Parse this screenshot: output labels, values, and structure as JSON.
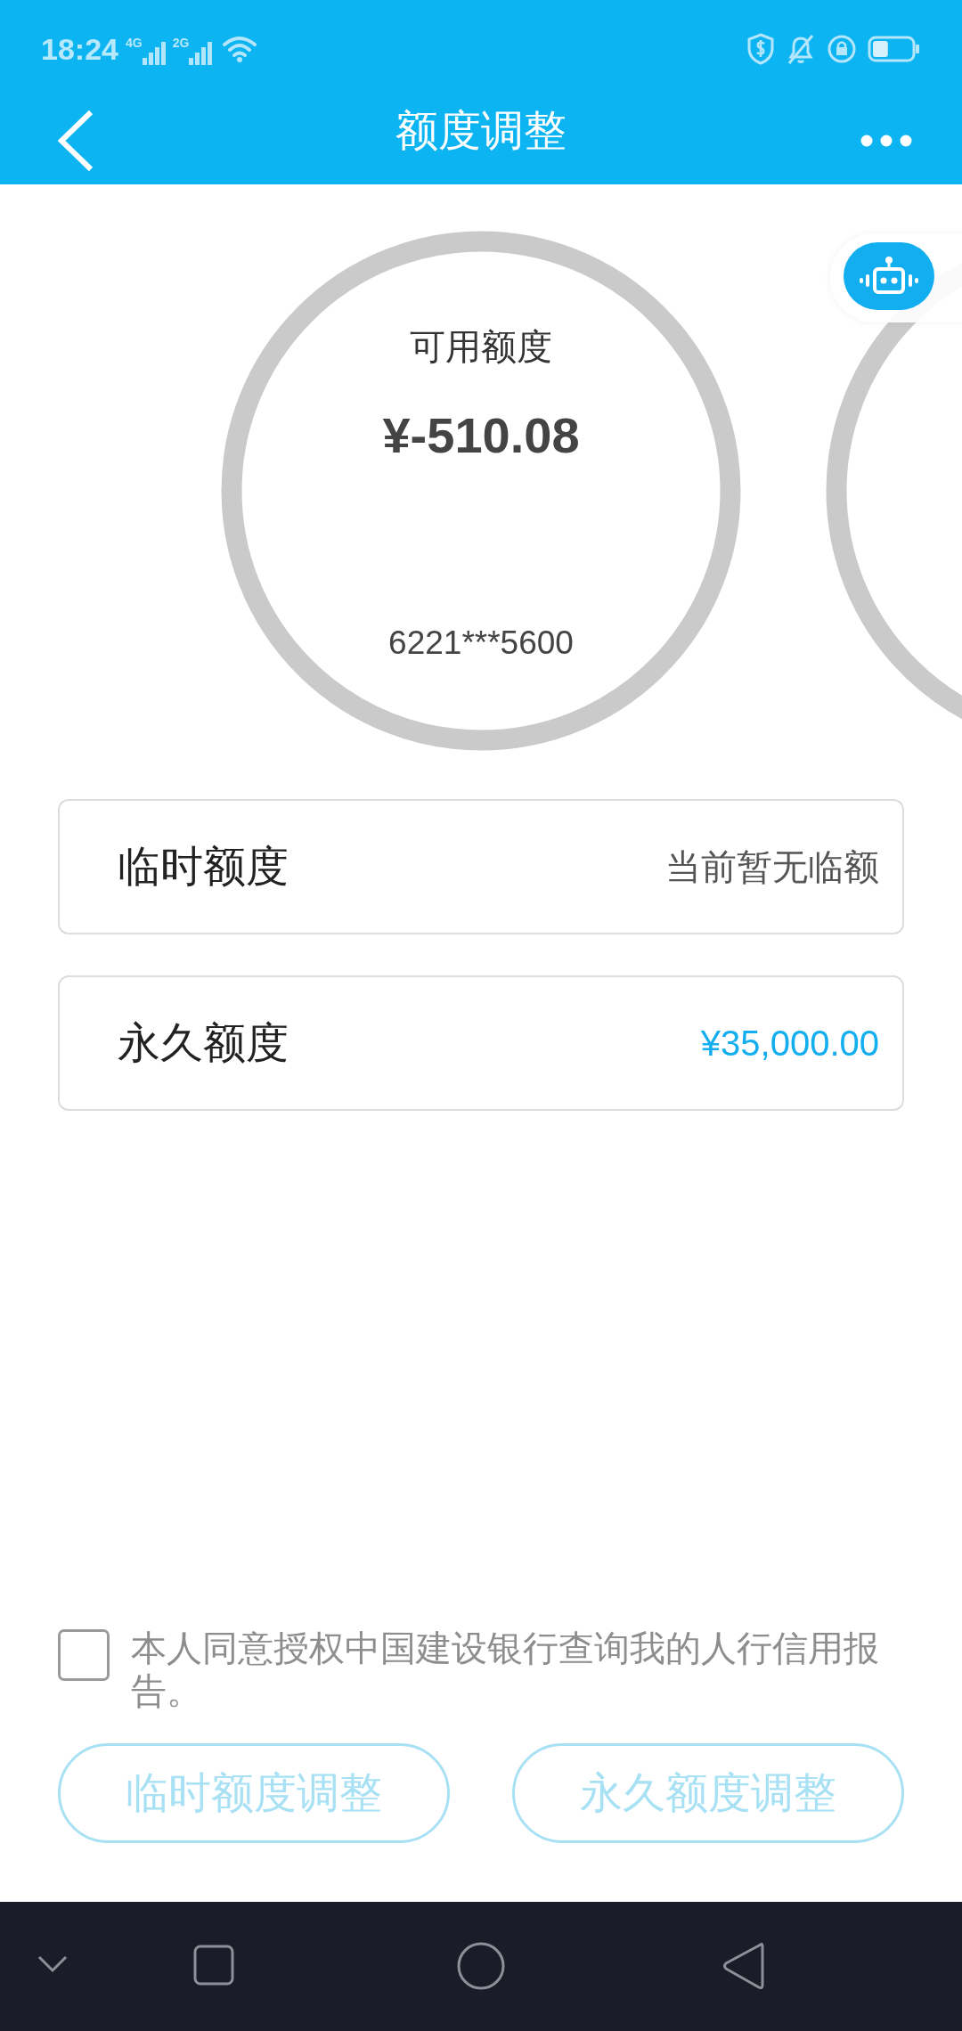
{
  "status_bar": {
    "time": "18:24",
    "network_1": "4G",
    "network_2": "2G"
  },
  "header": {
    "title": "额度调整"
  },
  "balance": {
    "label": "可用额度",
    "amount": "¥-510.08",
    "card_number": "6221***5600"
  },
  "limits": [
    {
      "label": "临时额度",
      "value": "当前暂无临额",
      "highlight": false
    },
    {
      "label": "永久额度",
      "value": "¥35,000.00",
      "highlight": true
    }
  ],
  "consent": {
    "checked": false,
    "text": "本人同意授权中国建设银行查询我的人行信用报告。"
  },
  "buttons": [
    {
      "label": "临时额度调整",
      "disabled": true
    },
    {
      "label": "永久额度调整",
      "disabled": true
    }
  ]
}
